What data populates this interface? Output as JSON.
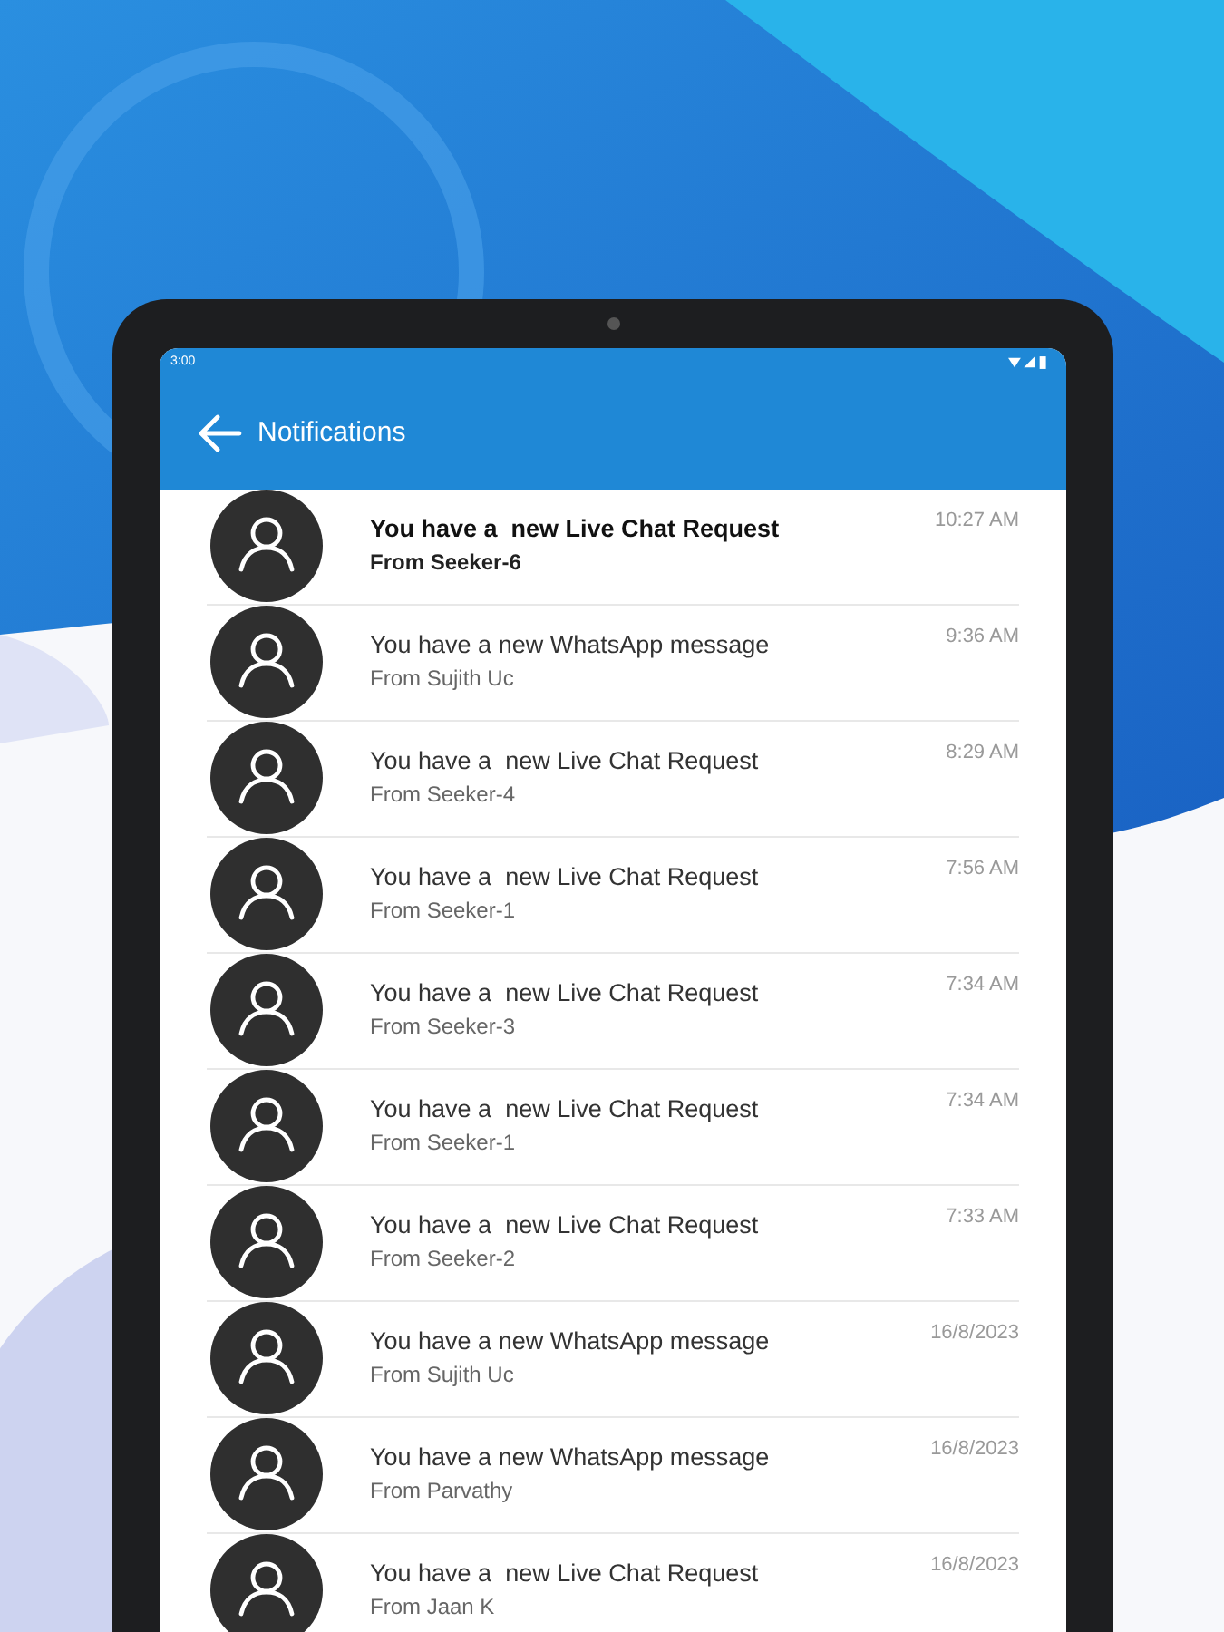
{
  "status_bar": {
    "time": "3:00"
  },
  "app_bar": {
    "title": "Notifications"
  },
  "notifications": [
    {
      "title": "You have a  new Live Chat Request",
      "sender": "From Seeker-6",
      "time": "10:27 AM",
      "unread": true
    },
    {
      "title": "You have a new WhatsApp message",
      "sender": "From Sujith Uc",
      "time": "9:36 AM",
      "unread": false
    },
    {
      "title": "You have a  new Live Chat Request",
      "sender": "From Seeker-4",
      "time": "8:29 AM",
      "unread": false
    },
    {
      "title": "You have a  new Live Chat Request",
      "sender": "From Seeker-1",
      "time": "7:56 AM",
      "unread": false
    },
    {
      "title": "You have a  new Live Chat Request",
      "sender": "From Seeker-3",
      "time": "7:34 AM",
      "unread": false
    },
    {
      "title": "You have a  new Live Chat Request",
      "sender": "From Seeker-1",
      "time": "7:34 AM",
      "unread": false
    },
    {
      "title": "You have a  new Live Chat Request",
      "sender": "From Seeker-2",
      "time": "7:33 AM",
      "unread": false
    },
    {
      "title": "You have a new WhatsApp message",
      "sender": "From Sujith Uc",
      "time": "16/8/2023",
      "unread": false
    },
    {
      "title": "You have a new WhatsApp message",
      "sender": "From Parvathy",
      "time": "16/8/2023",
      "unread": false
    },
    {
      "title": "You have a  new Live Chat Request",
      "sender": "From Jaan K",
      "time": "16/8/2023",
      "unread": false
    }
  ]
}
